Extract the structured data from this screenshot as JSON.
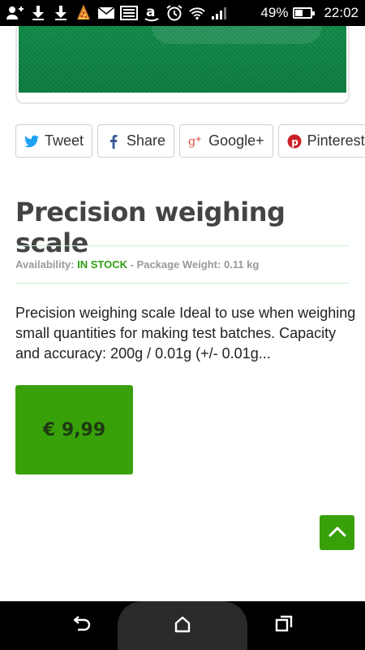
{
  "status_bar": {
    "battery_percent": "49%",
    "time": "22:02",
    "battery_level": 0.49,
    "icons": [
      "add-contact-icon",
      "download-icon",
      "download-icon",
      "pizza-icon",
      "mail-icon",
      "image-icon",
      "amazon-icon",
      "alarm-icon",
      "wifi-icon",
      "signal-icon"
    ]
  },
  "share": {
    "tweet": "Tweet",
    "share": "Share",
    "google": "Google+",
    "pinterest": "Pinterest"
  },
  "colors": {
    "accent_green": "#38a10a",
    "stock_green": "#2f9d12",
    "twitter": "#1da1f2",
    "facebook": "#3b5998",
    "google": "#dd4b39",
    "pinterest": "#cb2027"
  },
  "product": {
    "title": "Precision weighing scale",
    "availability_label": "Availability: ",
    "stock_status": "IN STOCK",
    "weight_text": " - Package Weight: 0.11 kg",
    "description": "Precision weighing scale Ideal to use when weighing small quantities for making test batches. Capacity and accuracy: 200g / 0.01g (+/- 0.01g...",
    "price": "€ 9,99"
  },
  "nav": {
    "back": "back-icon",
    "home": "home-icon",
    "recents": "recents-icon"
  }
}
